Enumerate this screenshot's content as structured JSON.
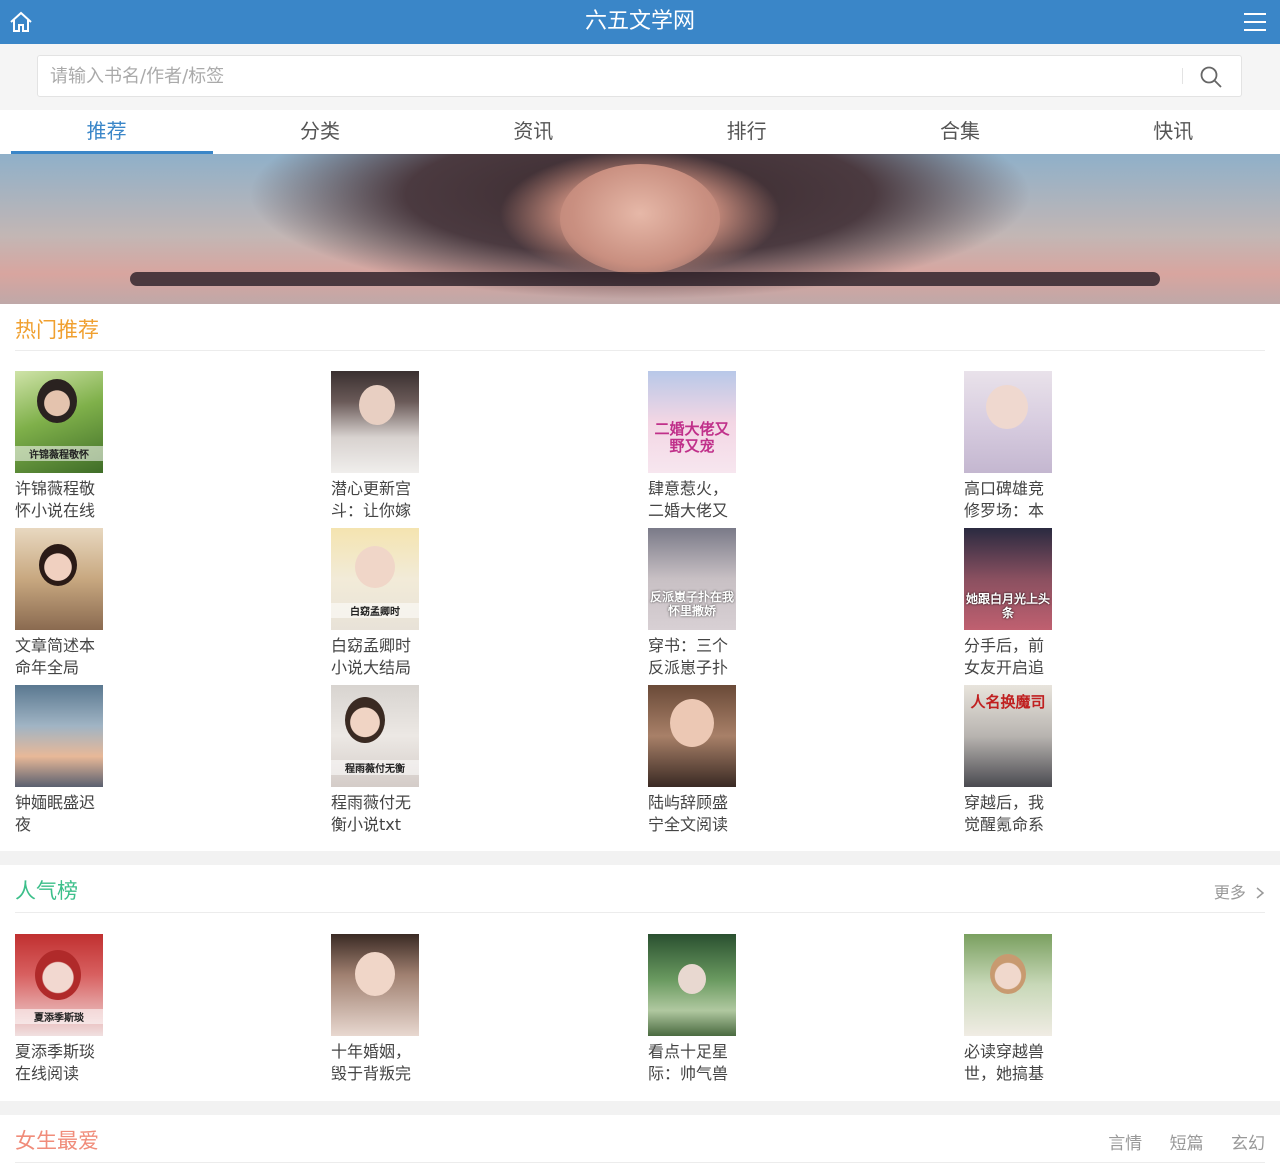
{
  "header": {
    "title": "六五文学网",
    "home_icon": "home-icon",
    "menu_icon": "menu-icon"
  },
  "search": {
    "placeholder": "请输入书名/作者/标签",
    "icon": "search-icon"
  },
  "tabs": [
    {
      "label": "推荐",
      "active": true
    },
    {
      "label": "分类",
      "active": false
    },
    {
      "label": "资讯",
      "active": false
    },
    {
      "label": "排行",
      "active": false
    },
    {
      "label": "合集",
      "active": false
    },
    {
      "label": "快讯",
      "active": false
    }
  ],
  "colors": {
    "brand": "#3a86c8",
    "hot": "#f0a030",
    "popular": "#3cbf8a",
    "female": "#f08c7a"
  },
  "hot": {
    "title": "热门推荐",
    "books": [
      {
        "name": "许锦薇程敬怀小说在线",
        "cover_text": "许锦薇程敬怀"
      },
      {
        "name": "潜心更新宫斗：让你嫁",
        "cover_text": ""
      },
      {
        "name": "肆意惹火，二婚大佬又",
        "cover_text": "二婚大佬又野又宠"
      },
      {
        "name": "高口碑雄竞修罗场：本",
        "cover_text": ""
      },
      {
        "name": "文章简述本命年全局",
        "cover_text": ""
      },
      {
        "name": "白窈孟卿时小说大结局",
        "cover_text": "白窈孟卿时"
      },
      {
        "name": "穿书：三个反派崽子扑",
        "cover_text": "反派崽子扑在我怀里撒娇"
      },
      {
        "name": "分手后，前女友开启追",
        "cover_text": "她跟白月光上头条"
      },
      {
        "name": "钟媔眠盛迟夜",
        "cover_text": ""
      },
      {
        "name": "程雨薇付无衡小说txt",
        "cover_text": "程雨薇付无衡"
      },
      {
        "name": "陆屿辞顾盛宁全文阅读",
        "cover_text": ""
      },
      {
        "name": "穿越后，我觉醒氪命系",
        "cover_text": "人名换魔司"
      }
    ]
  },
  "popular": {
    "title": "人气榜",
    "more": "更多",
    "books": [
      {
        "name": "夏添季斯琰在线阅读",
        "cover_text": "夏添季斯琰"
      },
      {
        "name": "十年婚姻，毁于背叛完",
        "cover_text": ""
      },
      {
        "name": "看点十足星际：帅气兽",
        "cover_text": ""
      },
      {
        "name": "必读穿越兽世，她搞基",
        "cover_text": ""
      }
    ]
  },
  "female": {
    "title": "女生最爱",
    "links": [
      "言情",
      "短篇",
      "玄幻"
    ]
  }
}
